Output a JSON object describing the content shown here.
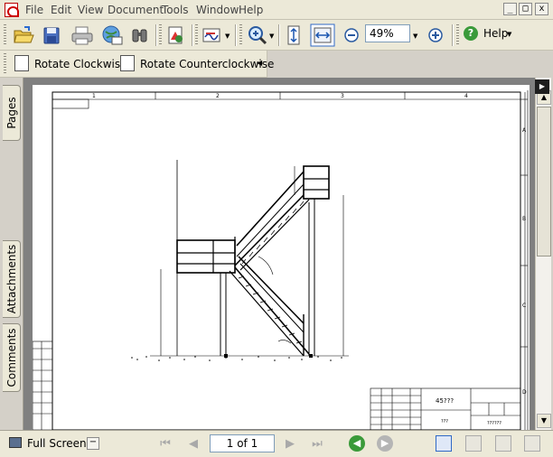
{
  "menubar": {
    "items": [
      "File",
      "Edit",
      "View",
      "Document",
      "Tools",
      "Window",
      "Help"
    ],
    "window_buttons": [
      "_",
      "□",
      "x"
    ]
  },
  "toolbar": {
    "zoom_value": "49%",
    "help_label": "Help",
    "icons": [
      "open-icon",
      "save-icon",
      "print-icon",
      "email-icon",
      "search-icon",
      "create-pdf-icon",
      "sign-icon",
      "zoom-in-icon",
      "fit-page-icon",
      "fit-width-icon",
      "zoom-out-icon",
      "zoom-plus-icon",
      "help-icon"
    ]
  },
  "rotate_toolbar": {
    "rotate_cw_label": "Rotate Clockwise",
    "rotate_ccw_label": "Rotate Counterclockwise"
  },
  "navigation_tabs": [
    "Pages",
    "Attachments",
    "Comments"
  ],
  "drawing": {
    "column_markers": [
      "1",
      "2",
      "3",
      "4"
    ],
    "row_markers": [
      "A",
      "B",
      "C",
      "D"
    ],
    "title_block_code": "45???",
    "title_block_small": "???",
    "title_block_ref": "??????"
  },
  "statusbar": {
    "full_screen_label": "Full Screen",
    "page_indicator": "1 of 1"
  },
  "colors": {
    "chrome": "#ece9d8",
    "doc_background": "#808080",
    "nav_green": "#3a9a3a"
  }
}
